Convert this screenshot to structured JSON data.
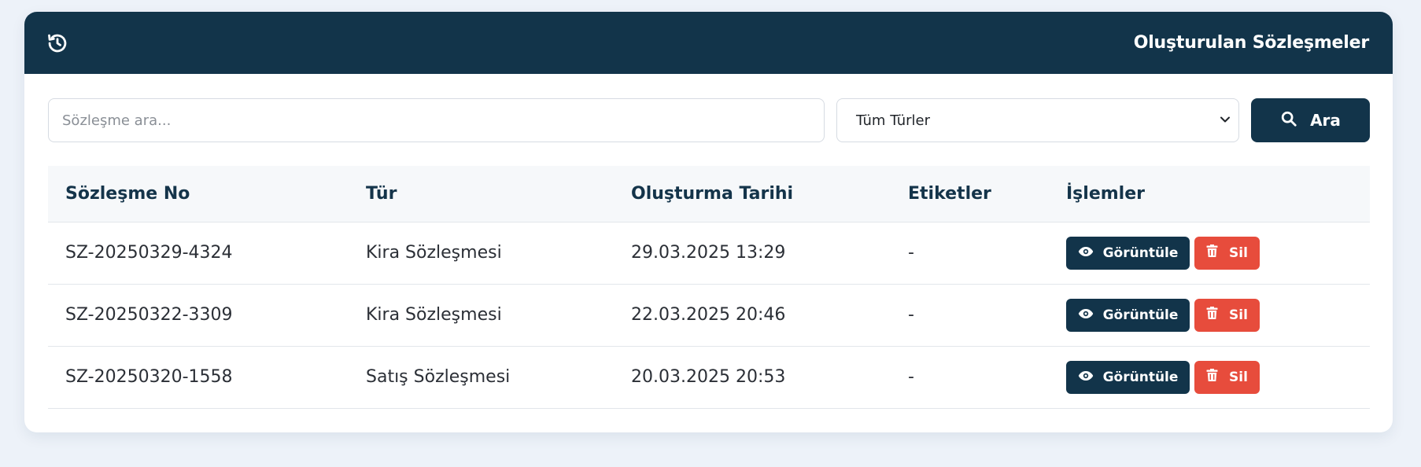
{
  "header": {
    "title": "Oluşturulan Sözleşmeler",
    "icon": "history-icon"
  },
  "toolbar": {
    "search_placeholder": "Sözleşme ara...",
    "search_value": "",
    "type_filter_selected": "Tüm Türler",
    "search_button_label": "Ara"
  },
  "table": {
    "columns": [
      "Sözleşme No",
      "Tür",
      "Oluşturma Tarihi",
      "Etiketler",
      "İşlemler"
    ],
    "rows": [
      {
        "no": "SZ-20250329-4324",
        "type": "Kira Sözleşmesi",
        "date": "29.03.2025 13:29",
        "tags": "-",
        "view_label": "Görüntüle",
        "delete_label": "Sil"
      },
      {
        "no": "SZ-20250322-3309",
        "type": "Kira Sözleşmesi",
        "date": "22.03.2025 20:46",
        "tags": "-",
        "view_label": "Görüntüle",
        "delete_label": "Sil"
      },
      {
        "no": "SZ-20250320-1558",
        "type": "Satış Sözleşmesi",
        "date": "20.03.2025 20:53",
        "tags": "-",
        "view_label": "Görüntüle",
        "delete_label": "Sil"
      }
    ]
  },
  "colors": {
    "primary": "#12344a",
    "danger": "#e74c3c",
    "page_background": "#edf2f9"
  }
}
